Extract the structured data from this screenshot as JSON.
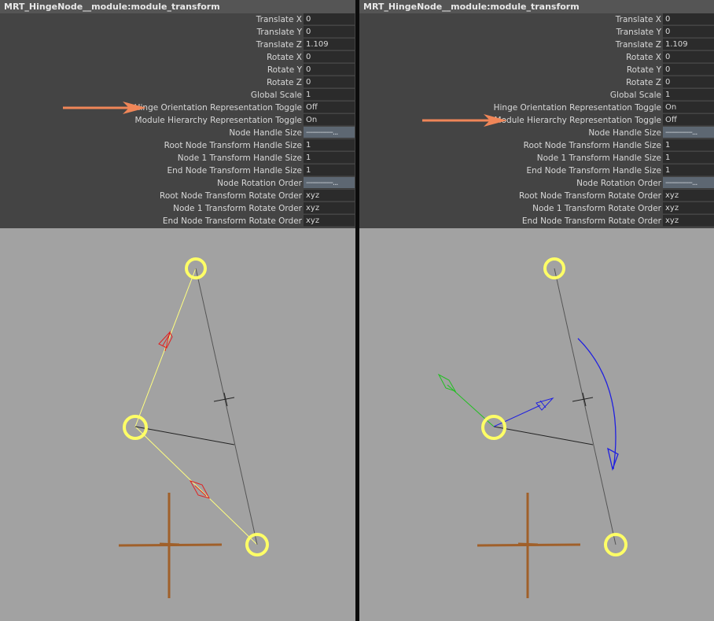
{
  "panels": [
    {
      "title": "MRT_HingeNode__module:module_transform",
      "rows": [
        {
          "label": "Translate X",
          "value": "0"
        },
        {
          "label": "Translate Y",
          "value": "0"
        },
        {
          "label": "Translate Z",
          "value": "1.109"
        },
        {
          "label": "Rotate X",
          "value": "0"
        },
        {
          "label": "Rotate Y",
          "value": "0"
        },
        {
          "label": "Rotate Z",
          "value": "0"
        },
        {
          "label": "Global Scale",
          "value": "1"
        },
        {
          "label": "Hinge Orientation Representation Toggle",
          "value": "Off"
        },
        {
          "label": "Module Hierarchy Representation Toggle",
          "value": "On"
        },
        {
          "label": "Node Handle Size",
          "value": "-------------..."
        },
        {
          "label": "Root Node Transform Handle Size",
          "value": "1"
        },
        {
          "label": "Node 1 Transform Handle Size",
          "value": "1"
        },
        {
          "label": "End Node Transform Handle Size",
          "value": "1"
        },
        {
          "label": "Node Rotation Order",
          "value": "-------------..."
        },
        {
          "label": "Root Node Transform Rotate Order",
          "value": "xyz"
        },
        {
          "label": "Node 1 Transform Rotate Order",
          "value": "xyz"
        },
        {
          "label": "End Node Transform Rotate Order",
          "value": "xyz"
        }
      ]
    },
    {
      "title": "MRT_HingeNode__module:module_transform",
      "rows": [
        {
          "label": "Translate X",
          "value": "0"
        },
        {
          "label": "Translate Y",
          "value": "0"
        },
        {
          "label": "Translate Z",
          "value": "1.109"
        },
        {
          "label": "Rotate X",
          "value": "0"
        },
        {
          "label": "Rotate Y",
          "value": "0"
        },
        {
          "label": "Rotate Z",
          "value": "0"
        },
        {
          "label": "Global Scale",
          "value": "1"
        },
        {
          "label": "Hinge Orientation Representation Toggle",
          "value": "On"
        },
        {
          "label": "Module Hierarchy Representation Toggle",
          "value": "Off"
        },
        {
          "label": "Node Handle Size",
          "value": "-------------..."
        },
        {
          "label": "Root Node Transform Handle Size",
          "value": "1"
        },
        {
          "label": "Node 1 Transform Handle Size",
          "value": "1"
        },
        {
          "label": "End Node Transform Handle Size",
          "value": "1"
        },
        {
          "label": "Node Rotation Order",
          "value": "-------------..."
        },
        {
          "label": "Root Node Transform Rotate Order",
          "value": "xyz"
        },
        {
          "label": "Node 1 Transform Rotate Order",
          "value": "xyz"
        },
        {
          "label": "End Node Transform Rotate Order",
          "value": "xyz"
        }
      ]
    }
  ],
  "colors": {
    "highlight_arrow": "#f08658",
    "node_ring": "#ffff66",
    "hierarchy_line": "#ffff80",
    "hierarchy_arrow": "#e02020",
    "orient_x_axis": "#2020e0",
    "orient_y_axis": "#20c020",
    "grid_cross": "#a0602a",
    "viewport_bg": "#a2a2a2"
  },
  "icons": [
    "highlight-arrow-icon",
    "node-ring-icon",
    "hierarchy-arrow-icon",
    "orientation-axis-icon",
    "world-origin-cross-icon"
  ]
}
